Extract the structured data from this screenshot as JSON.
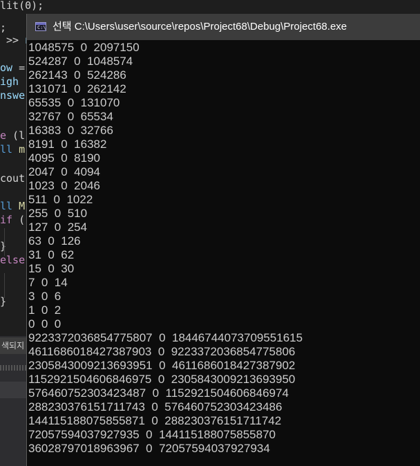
{
  "ide": {
    "code_fragments": [
      {
        "parts": [
          {
            "t": "lit(0);",
            "c": ""
          }
        ]
      },
      {
        "parts": [
          {
            "t": ";",
            "c": ""
          }
        ]
      },
      {
        "parts": [
          {
            "t": " >> ",
            "c": ""
          },
          {
            "t": "n",
            "c": "var"
          }
        ]
      },
      {
        "parts": [
          {
            "t": "ow",
            "c": "var"
          },
          {
            "t": " =",
            "c": ""
          }
        ]
      },
      {
        "parts": [
          {
            "t": "igh",
            "c": "var"
          }
        ]
      },
      {
        "parts": [
          {
            "t": "nswe",
            "c": "var"
          }
        ]
      },
      {
        "parts": [
          {
            "t": "e",
            "c": "purple"
          },
          {
            "t": " (l",
            "c": ""
          }
        ]
      },
      {
        "parts": [
          {
            "t": "ll",
            "c": "kw"
          },
          {
            "t": " m",
            "c": "fn"
          }
        ]
      },
      {
        "parts": [
          {
            "t": "cout",
            "c": ""
          }
        ]
      },
      {
        "parts": [
          {
            "t": "ll",
            "c": "kw"
          },
          {
            "t": " M",
            "c": "fn"
          }
        ]
      },
      {
        "parts": [
          {
            "t": "if",
            "c": "purple"
          },
          {
            "t": " (",
            "c": ""
          }
        ]
      },
      {
        "parts": [
          {
            "t": "}",
            "c": ""
          }
        ]
      },
      {
        "parts": [
          {
            "t": "else",
            "c": "purple"
          }
        ]
      },
      {
        "parts": [
          {
            "t": "}",
            "c": ""
          }
        ]
      }
    ],
    "bottom_panel_tab": "색되지"
  },
  "console_window": {
    "title": "선택 C:\\Users\\user\\source\\repos\\Project68\\Debug\\Project68.exe",
    "icon": "console-app-icon",
    "output_lines": [
      "1048575  0  2097150",
      "524287  0  1048574",
      "262143  0  524286",
      "131071  0  262142",
      "65535  0  131070",
      "32767  0  65534",
      "16383  0  32766",
      "8191  0  16382",
      "4095  0  8190",
      "2047  0  4094",
      "1023  0  2046",
      "511  0  1022",
      "255  0  510",
      "127  0  254",
      "63  0  126",
      "31  0  62",
      "15  0  30",
      "7  0  14",
      "3  0  6",
      "1  0  2",
      "0  0  0",
      "9223372036854775807  0  18446744073709551615",
      "4611686018427387903  0  9223372036854775806",
      "2305843009213693951  0  4611686018427387902",
      "1152921504606846975  0  2305843009213693950",
      "576460752303423487  0  1152921504606846974",
      "288230376151711743  0  576460752303423486",
      "144115188075855871  0  288230376151711742",
      "72057594037927935  0  144115188075855870",
      "36028797018963967  0  72057594037927934"
    ]
  },
  "colors": {
    "console_bg": "#0c0c0c",
    "console_text": "#cccccc",
    "titlebar_bg": "#3c3c3c",
    "editor_bg": "#1e1e1e"
  }
}
